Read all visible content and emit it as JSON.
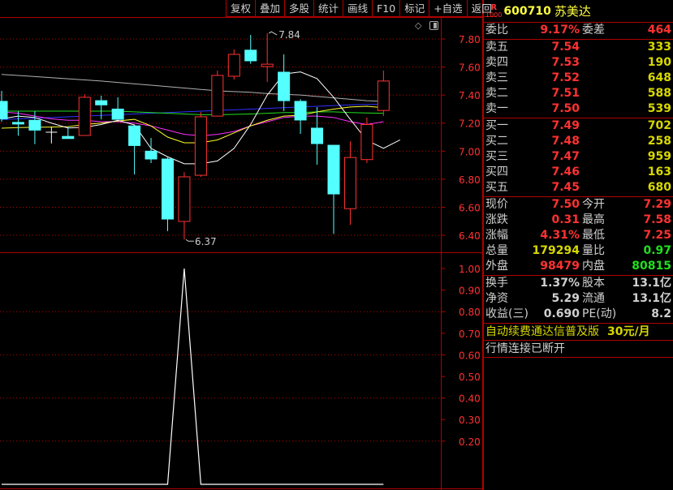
{
  "toolbar": [
    "复权",
    "叠加",
    "多股",
    "统计",
    "画线",
    "F10",
    "标记",
    "+自选",
    "返回"
  ],
  "stock": {
    "badge_top": "R",
    "badge_bottom": "1000",
    "code": "600710",
    "name": "苏美达"
  },
  "weibi": {
    "label": "委比",
    "value": "9.17%",
    "label2": "委差",
    "value2": "464"
  },
  "sell": [
    {
      "label": "卖五",
      "price": "7.54",
      "vol": "333"
    },
    {
      "label": "卖四",
      "price": "7.53",
      "vol": "190"
    },
    {
      "label": "卖三",
      "price": "7.52",
      "vol": "648"
    },
    {
      "label": "卖二",
      "price": "7.51",
      "vol": "588"
    },
    {
      "label": "卖一",
      "price": "7.50",
      "vol": "539"
    }
  ],
  "buy": [
    {
      "label": "买一",
      "price": "7.49",
      "vol": "702"
    },
    {
      "label": "买二",
      "price": "7.48",
      "vol": "258"
    },
    {
      "label": "买三",
      "price": "7.47",
      "vol": "959"
    },
    {
      "label": "买四",
      "price": "7.46",
      "vol": "163"
    },
    {
      "label": "买五",
      "price": "7.45",
      "vol": "680"
    }
  ],
  "quote": [
    {
      "l": "现价",
      "v": "7.50",
      "c": "red",
      "l2": "今开",
      "v2": "7.29",
      "c2": "red"
    },
    {
      "l": "涨跌",
      "v": "0.31",
      "c": "red",
      "l2": "最高",
      "v2": "7.58",
      "c2": "red"
    },
    {
      "l": "涨幅",
      "v": "4.31%",
      "c": "red",
      "l2": "最低",
      "v2": "7.25",
      "c2": "red"
    },
    {
      "l": "总量",
      "v": "179294",
      "c": "yel",
      "l2": "量比",
      "v2": "0.97",
      "c2": "grn"
    },
    {
      "l": "外盘",
      "v": "98479",
      "c": "red",
      "l2": "内盘",
      "v2": "80815",
      "c2": "grn"
    }
  ],
  "fund": [
    {
      "l": "换手",
      "v": "1.37%",
      "l2": "股本",
      "v2": "13.1亿"
    },
    {
      "l": "净资",
      "v": "5.29",
      "l2": "流通",
      "v2": "13.1亿"
    },
    {
      "l": "收益(三)",
      "v": "0.690",
      "l2": "PE(动)",
      "v2": "8.2"
    }
  ],
  "ad": {
    "text": "自动续费通达信普及版",
    "price": "30元/月"
  },
  "status": "行情连接已断开",
  "colors": {
    "up": "#ff3232",
    "down": "#54ffff",
    "grid": "#c00000",
    "axis": "#ff3232"
  },
  "chart_data": [
    {
      "type": "candlestick",
      "ylim": [
        6.3,
        7.9
      ],
      "yticks": [
        "7.80",
        "7.60",
        "7.40",
        "7.20",
        "7.00",
        "6.80",
        "6.60",
        "6.40"
      ],
      "annotations": {
        "high": "7.84",
        "low": "6.37"
      },
      "candles": [
        [
          7.355,
          7.23,
          7.43,
          7.21
        ],
        [
          7.205,
          7.195,
          7.285,
          7.11
        ],
        [
          7.22,
          7.15,
          7.285,
          7.05
        ],
        [
          7.135,
          7.135,
          7.175,
          7.055
        ],
        [
          7.105,
          7.09,
          7.175,
          7.09
        ],
        [
          7.112,
          7.384,
          7.406,
          7.112
        ],
        [
          7.36,
          7.33,
          7.395,
          7.227
        ],
        [
          7.3,
          7.227,
          7.384,
          7.227
        ],
        [
          7.18,
          7.04,
          7.18,
          6.834
        ],
        [
          7.0,
          6.944,
          7.094,
          6.915
        ],
        [
          6.944,
          6.516,
          6.955,
          6.43
        ],
        [
          6.499,
          6.817,
          6.85,
          6.37
        ],
        [
          6.828,
          7.245,
          7.28,
          6.817
        ],
        [
          7.25,
          7.54,
          7.574,
          7.25
        ],
        [
          7.534,
          7.69,
          7.725,
          7.51
        ],
        [
          7.72,
          7.644,
          7.829,
          7.623
        ],
        [
          7.603,
          7.62,
          7.84,
          7.493
        ],
        [
          7.563,
          7.36,
          7.69,
          7.285
        ],
        [
          7.355,
          7.222,
          7.37,
          7.123
        ],
        [
          7.164,
          7.054,
          7.314,
          6.904
        ],
        [
          7.042,
          6.695,
          7.042,
          6.41
        ],
        [
          6.59,
          6.955,
          7.07,
          6.475
        ],
        [
          6.94,
          7.19,
          7.24,
          6.915
        ],
        [
          7.29,
          7.5,
          7.574,
          7.25
        ]
      ],
      "series": [
        {
          "name": "MA-gray",
          "color": "#b0b0b0",
          "values": [
            7.547,
            7.54,
            7.532,
            7.524,
            7.516,
            7.508,
            7.5,
            7.49,
            7.48,
            7.47,
            7.46,
            7.45,
            7.44,
            7.43,
            7.425,
            7.42,
            7.41,
            7.405,
            7.4,
            7.39,
            7.38,
            7.37,
            7.36,
            7.355
          ]
        },
        {
          "name": "MA-blue",
          "color": "#3030ff",
          "values": [
            7.225,
            7.23,
            7.235,
            7.24,
            7.245,
            7.25,
            7.255,
            7.26,
            7.265,
            7.27,
            7.275,
            7.28,
            7.285,
            7.29,
            7.295,
            7.3,
            7.305,
            7.31,
            7.315,
            7.32,
            7.325,
            7.33,
            7.333,
            7.335
          ]
        },
        {
          "name": "MA-green",
          "color": "#20e020",
          "values": [
            7.285,
            7.285,
            7.285,
            7.285,
            7.285,
            7.285,
            7.285,
            7.285,
            7.28,
            7.275,
            7.27,
            7.265,
            7.26,
            7.26,
            7.262,
            7.265,
            7.27,
            7.275,
            7.275,
            7.28,
            7.28,
            7.275,
            7.272,
            7.27
          ]
        },
        {
          "name": "MA-magenta",
          "color": "#ff30ff",
          "values": [
            7.28,
            7.27,
            7.25,
            7.23,
            7.22,
            7.22,
            7.21,
            7.21,
            7.2,
            7.18,
            7.15,
            7.12,
            7.11,
            7.12,
            7.14,
            7.18,
            7.21,
            7.24,
            7.25,
            7.25,
            7.24,
            7.21,
            7.19,
            7.21
          ]
        },
        {
          "name": "MA-yellow",
          "color": "#ffff30",
          "values": [
            7.164,
            7.168,
            7.17,
            7.172,
            7.175,
            7.19,
            7.2,
            7.215,
            7.227,
            7.18,
            7.1,
            7.06,
            7.06,
            7.08,
            7.13,
            7.18,
            7.22,
            7.25,
            7.256,
            7.28,
            7.3,
            7.315,
            7.32,
            7.31
          ]
        },
        {
          "name": "MA-white",
          "color": "#ffffff",
          "values": [
            7.23,
            7.25,
            7.24,
            7.2,
            7.165,
            7.17,
            7.19,
            7.22,
            7.187,
            7.02,
            6.96,
            6.91,
            6.91,
            6.93,
            7.02,
            7.19,
            7.4,
            7.55,
            7.565,
            7.517,
            7.384,
            7.227,
            7.077,
            7.02,
            7.08
          ]
        }
      ]
    },
    {
      "type": "line",
      "ylim": [
        0,
        1.0
      ],
      "yticks": [
        "1.00",
        "0.90",
        "0.80",
        "0.70",
        "0.60",
        "0.50",
        "0.40",
        "0.30",
        "0.20"
      ],
      "values": [
        0,
        0,
        0,
        0,
        0,
        0,
        0,
        0,
        0,
        0,
        0,
        1,
        0,
        0,
        0,
        0,
        0,
        0,
        0,
        0,
        0,
        0,
        0,
        0
      ]
    }
  ]
}
